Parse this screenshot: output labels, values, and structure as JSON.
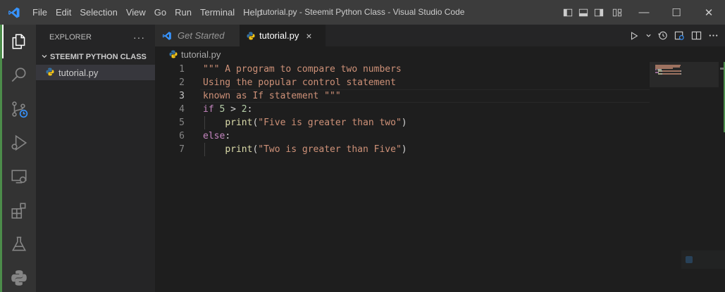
{
  "menu": [
    "File",
    "Edit",
    "Selection",
    "View",
    "Go",
    "Run",
    "Terminal",
    "Help"
  ],
  "window_title": "tutorial.py - Steemit Python Class - Visual Studio Code",
  "window_controls": {
    "minimize": "—",
    "maximize": "☐",
    "close": "✕"
  },
  "sidebar": {
    "header": "EXPLORER",
    "more": "···",
    "folder": "STEEMIT PYTHON CLASS",
    "files": [
      "tutorial.py"
    ]
  },
  "tabs": [
    {
      "label": "Get Started",
      "active": false
    },
    {
      "label": "tutorial.py",
      "active": true,
      "close": "×"
    }
  ],
  "breadcrumb": "tutorial.py",
  "editor": {
    "current_line": 3,
    "lines": [
      {
        "num": "1",
        "tokens": [
          {
            "t": "\"\"\" A program to compare two numbers",
            "c": "str"
          }
        ]
      },
      {
        "num": "2",
        "tokens": [
          {
            "t": "Using the popular control statement",
            "c": "str"
          }
        ]
      },
      {
        "num": "3",
        "tokens": [
          {
            "t": "known as If statement \"\"\"",
            "c": "str"
          }
        ]
      },
      {
        "num": "4",
        "tokens": [
          {
            "t": "if",
            "c": "kw"
          },
          {
            "t": " ",
            "c": "op"
          },
          {
            "t": "5",
            "c": "num"
          },
          {
            "t": " > ",
            "c": "op"
          },
          {
            "t": "2",
            "c": "num"
          },
          {
            "t": ":",
            "c": "op"
          }
        ]
      },
      {
        "num": "5",
        "indent": true,
        "tokens": [
          {
            "t": "    ",
            "c": "op"
          },
          {
            "t": "print",
            "c": "fn"
          },
          {
            "t": "(",
            "c": "op"
          },
          {
            "t": "\"Five is greater than two\"",
            "c": "str"
          },
          {
            "t": ")",
            "c": "op"
          }
        ]
      },
      {
        "num": "6",
        "tokens": [
          {
            "t": "else",
            "c": "kw"
          },
          {
            "t": ":",
            "c": "op"
          }
        ]
      },
      {
        "num": "7",
        "indent": true,
        "tokens": [
          {
            "t": "    ",
            "c": "op"
          },
          {
            "t": "print",
            "c": "fn"
          },
          {
            "t": "(",
            "c": "op"
          },
          {
            "t": "\"Two is greater than Five\"",
            "c": "str"
          },
          {
            "t": ")",
            "c": "op"
          }
        ]
      }
    ]
  },
  "colors": {
    "accent_blue": "#3794ff",
    "python_yellow": "#f5c518",
    "python_blue": "#3572a5",
    "string": "#ce9178",
    "keyword": "#c586c0",
    "number": "#b5cea8",
    "function": "#dcdcaa"
  },
  "icons": {
    "activity": [
      "explorer-icon",
      "search-icon",
      "source-control-icon",
      "run-debug-icon",
      "remote-explorer-icon",
      "extensions-icon",
      "testing-icon",
      "python-icon"
    ],
    "tab_actions": [
      "run-icon",
      "chevron-down-icon",
      "timeline-icon",
      "open-preview-icon",
      "split-editor-icon",
      "more-actions-icon"
    ]
  }
}
